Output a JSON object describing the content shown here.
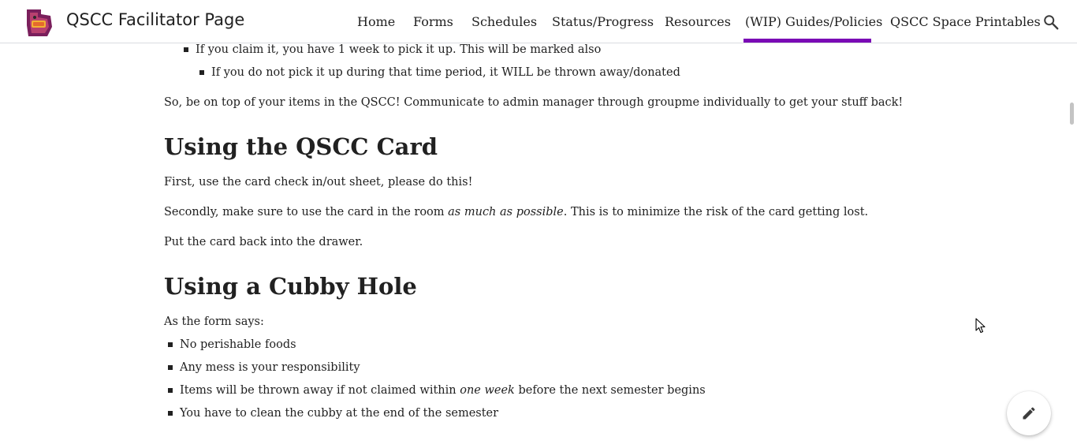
{
  "header": {
    "site_title": "QSCC Facilitator Page",
    "nav": [
      {
        "label": "Home"
      },
      {
        "label": "Forms"
      },
      {
        "label": "Schedules"
      },
      {
        "label": "Status/Progress"
      },
      {
        "label": "Resources"
      },
      {
        "label": "(WIP) Guides/Policies",
        "active": true
      },
      {
        "label": "QSCC Space Printables"
      }
    ],
    "search_icon": "search-icon",
    "accent_color": "#7a09b5"
  },
  "content": {
    "lost_items": {
      "bullet_claim": "If you claim it, you have 1 week to pick it up. This will be marked also",
      "bullet_pickup": "If you do not pick it up during that time period, it WILL be thrown away/donated",
      "closing": "So, be on top of your items in the QSCC! Communicate to admin manager through groupme individually to get your stuff back!"
    },
    "card_section": {
      "heading": "Using the QSCC Card",
      "p1": "First, use the card check in/out sheet, please do this!",
      "p2_before": "Secondly, make sure to use the card in the room ",
      "p2_em": "as much as possible",
      "p2_after": ". This is to minimize the risk of the card getting lost.",
      "p3": "Put the card back into the drawer."
    },
    "cubby_section": {
      "heading": "Using a Cubby Hole",
      "intro": "As the form says:",
      "rule1": "No perishable foods",
      "rule2": "Any mess is your responsibility",
      "rule3_before": "Items will be thrown away if not claimed within ",
      "rule3_em": "one week",
      "rule3_after": " before the next semester begins",
      "rule4": "You have to clean the cubby at the end of the semester"
    }
  },
  "fab": {
    "icon": "pencil-icon"
  }
}
